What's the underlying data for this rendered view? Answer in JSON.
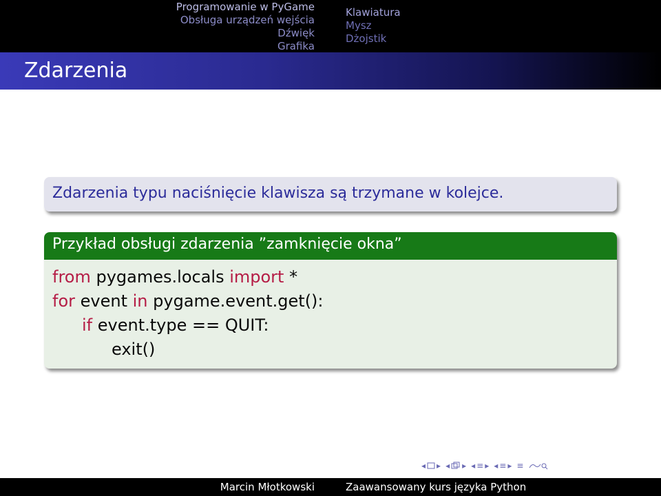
{
  "nav": {
    "section": "Programowanie w PyGame",
    "subsections_left": [
      "Obsługa urządzeń wejścia",
      "Dźwięk",
      "Grafika"
    ],
    "subsections_right": [
      "Klawiatura",
      "Mysz",
      "Dżojstik"
    ]
  },
  "frame": {
    "title": "Zdarzenia"
  },
  "block1": {
    "text": "Zdarzenia typu naciśnięcie klawisza są trzymane w kolejce."
  },
  "block2": {
    "title": "Przykład obsługi zdarzenia ”zamknięcie okna”",
    "code": {
      "line1_kw1": "from",
      "line1_mid": " pygames.locals ",
      "line1_kw2": "import",
      "line1_end": " *",
      "line2_kw1": "for",
      "line2_mid": " event ",
      "line2_kw2": "in",
      "line2_end": " pygame.event.get():",
      "line3_kw": "if",
      "line3_end": " event.type == QUIT:",
      "line4": "exit()"
    }
  },
  "navsymbols": [
    "frame-nav-icon",
    "subsection-nav-icon",
    "section-nav-icon",
    "document-nav-icon",
    "search-icon"
  ],
  "footer": {
    "author": "Marcin Młotkowski",
    "title": "Zaawansowany kurs języka Python"
  },
  "colors": {
    "nav_bg": "#000000",
    "title_bar_start": "#3a3ab8",
    "block_plain_bg": "#e3e3ed",
    "block_plain_text": "#2c2c9a",
    "block_example_title_bg": "#177a17",
    "block_example_bg": "#e8f0e6",
    "keyword": "#b51d46"
  }
}
